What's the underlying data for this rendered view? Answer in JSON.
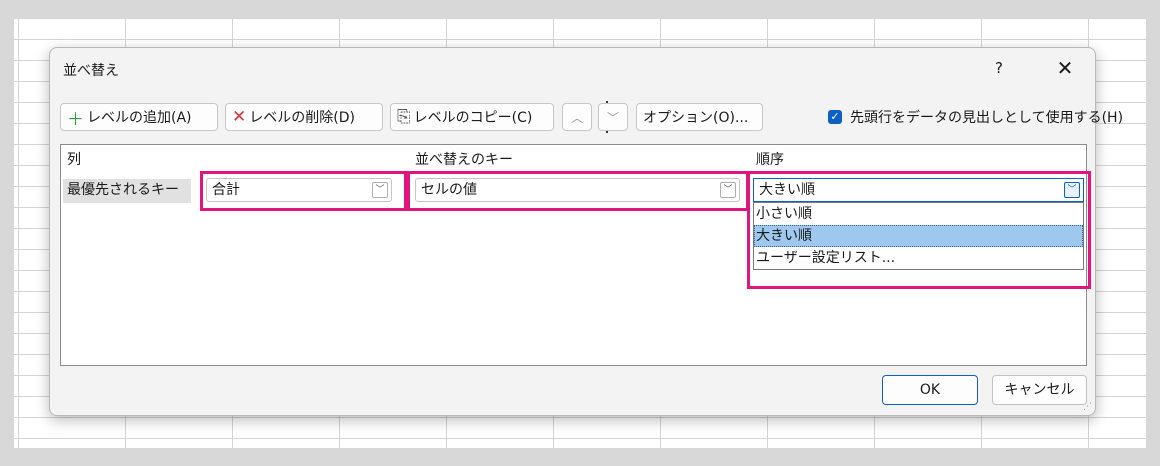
{
  "dialog": {
    "title": "並べ替え",
    "help": "?",
    "close": "✕"
  },
  "toolbar": {
    "add_level": {
      "icon": "＋",
      "label": "レベルの追加(A)"
    },
    "delete_level": {
      "icon": "✕",
      "label": "レベルの削除(D)"
    },
    "copy_level": {
      "icon": "⎘",
      "label": "レベルのコピー(C)"
    },
    "move_up": "︿",
    "move_down": "﹀",
    "options": "オプション(O)...",
    "header_checkbox": {
      "checked": true,
      "label": "先頭行をデータの見出しとして使用する(H)"
    }
  },
  "columns": {
    "column": "列",
    "sort_on": "並べ替えのキー",
    "order": "順序"
  },
  "rows": [
    {
      "label": "最優先されるキー",
      "column_value": "合計",
      "sort_on_value": "セルの値",
      "order_value": "大きい順"
    }
  ],
  "order_dropdown": {
    "options": [
      "小さい順",
      "大きい順",
      "ユーザー設定リスト..."
    ],
    "selected_index": 1
  },
  "footer": {
    "ok": "OK",
    "cancel": "キャンセル"
  },
  "colors": {
    "highlight": "#e0157d",
    "accent": "#0e5fc7",
    "selected_option": "#9ec8ee"
  }
}
